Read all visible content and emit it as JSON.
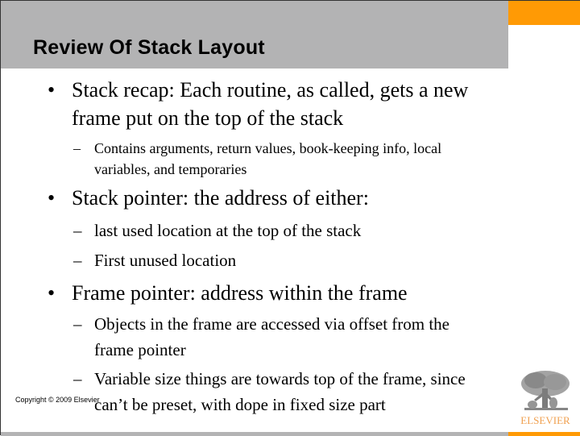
{
  "slide": {
    "title": "Review Of Stack Layout",
    "colors": {
      "header_gray": "#b3b3b4",
      "accent_orange": "#ff9a05",
      "logo_text": "#f0a050"
    },
    "bullets": [
      {
        "marker": "•",
        "lines": [
          "Stack recap: Each routine, as called, gets a new",
          "frame put on the top of the stack"
        ],
        "sub": [
          {
            "marker": "–",
            "lines": [
              "Contains arguments, return values, book-keeping info, local",
              "variables, and temporaries"
            ]
          }
        ]
      },
      {
        "marker": "•",
        "lines": [
          "Stack pointer: the address of either:"
        ],
        "sub": [
          {
            "marker": "–",
            "lines": [
              "last used location at the top of the stack"
            ]
          },
          {
            "marker": "–",
            "lines": [
              "First unused location"
            ]
          }
        ]
      },
      {
        "marker": "•",
        "lines": [
          "Frame pointer: address within the frame"
        ],
        "sub": [
          {
            "marker": "–",
            "lines": [
              "Objects in the frame are accessed via offset from the",
              "frame pointer"
            ]
          },
          {
            "marker": "–",
            "lines": [
              "Variable size things are towards top of the frame, since",
              "can’t be preset, with dope in fixed size part"
            ]
          }
        ]
      }
    ],
    "footer": {
      "copyright": "Copyright © 2009 Elsevier",
      "publisher_logo_text": "ELSEVIER",
      "publisher_logo_icon": "elsevier-tree-icon"
    }
  }
}
